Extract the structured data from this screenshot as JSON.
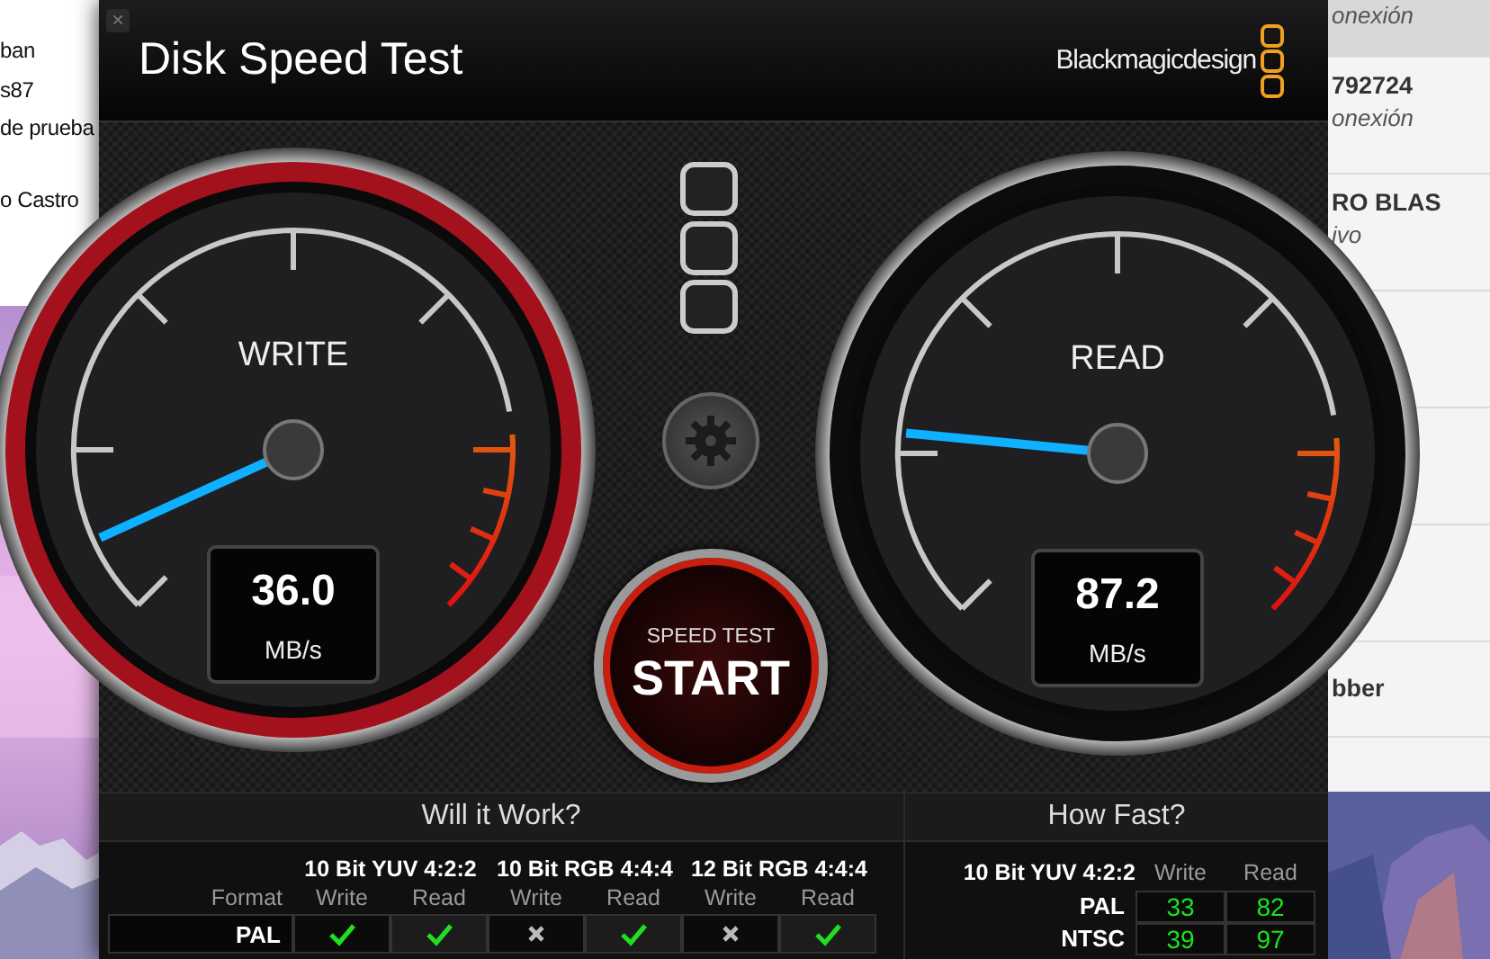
{
  "background_left": {
    "groups": [
      [
        "ban",
        "s87",
        "de prueba"
      ],
      [
        "o Castro"
      ]
    ]
  },
  "background_list": {
    "rows": [
      {
        "subtitle": "onexión"
      },
      {
        "title": "792724",
        "subtitle": "onexión"
      },
      {
        "title": "RO BLAS",
        "subtitle": "ivo"
      },
      {},
      {},
      {},
      {
        "title": "bber"
      },
      {}
    ]
  },
  "window": {
    "close": "×",
    "title": "Disk Speed Test",
    "brand": "Blackmagicdesign"
  },
  "gauges": [
    {
      "label": "WRITE",
      "value": "36.0",
      "unit": "MB/s",
      "level": 0.076,
      "color": "#a3121c"
    },
    {
      "label": "READ",
      "value": "87.2",
      "unit": "MB/s",
      "level": 0.187,
      "color": "#0c0c0c"
    }
  ],
  "start_button": {
    "caption": "SPEED TEST",
    "label": "START"
  },
  "will_it_work": {
    "title": "Will it Work?",
    "format_label": "Format",
    "groups": [
      {
        "name": "10 Bit YUV 4:2:2",
        "columns": [
          "Write",
          "Read"
        ]
      },
      {
        "name": "10 Bit RGB 4:4:4",
        "columns": [
          "Write",
          "Read"
        ]
      },
      {
        "name": "12 Bit RGB 4:4:4",
        "columns": [
          "Write",
          "Read"
        ]
      }
    ],
    "rows": [
      {
        "format": "PAL",
        "results": [
          {
            "ok": true
          },
          {
            "ok": true
          },
          {
            "ok": false
          },
          {
            "ok": true
          },
          {
            "ok": false
          },
          {
            "ok": true
          }
        ]
      }
    ]
  },
  "how_fast": {
    "title": "How Fast?",
    "format_group": "10 Bit YUV 4:2:2",
    "columns": [
      "Write",
      "Read"
    ],
    "rows": [
      {
        "format": "PAL",
        "write": "33",
        "read": "82"
      },
      {
        "format": "NTSC",
        "write": "39",
        "read": "97"
      }
    ]
  }
}
